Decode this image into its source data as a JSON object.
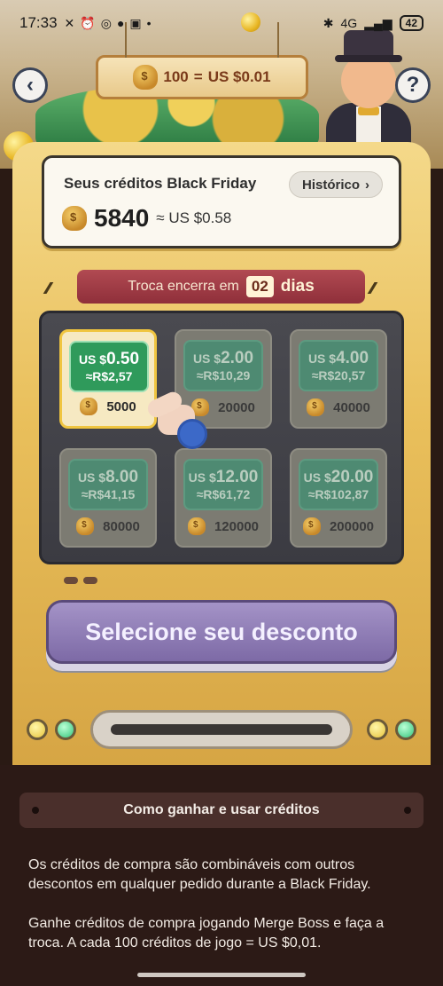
{
  "status": {
    "time": "17:33",
    "battery": "42",
    "network": "4G"
  },
  "header": {
    "rate_amount": "100",
    "rate_equals": "=",
    "rate_value": "US $0.01",
    "back_icon": "chevron-left-icon",
    "help_label": "?"
  },
  "credits": {
    "title": "Seus créditos Black Friday",
    "history_label": "Histórico",
    "amount": "5840",
    "approx": "≈ US $0.58"
  },
  "deadline": {
    "prefix": "Troca encerra em",
    "days": "02",
    "suffix": "dias"
  },
  "tiles": [
    {
      "usd_prefix": "US $",
      "usd": "0.50",
      "brl": "≈R$2,57",
      "cost": "5000",
      "selected": true
    },
    {
      "usd_prefix": "US $",
      "usd": "2.00",
      "brl": "≈R$10,29",
      "cost": "20000",
      "selected": false
    },
    {
      "usd_prefix": "US $",
      "usd": "4.00",
      "brl": "≈R$20,57",
      "cost": "40000",
      "selected": false
    },
    {
      "usd_prefix": "US $",
      "usd": "8.00",
      "brl": "≈R$41,15",
      "cost": "80000",
      "selected": false
    },
    {
      "usd_prefix": "US $",
      "usd": "12.00",
      "brl": "≈R$61,72",
      "cost": "120000",
      "selected": false
    },
    {
      "usd_prefix": "US $",
      "usd": "20.00",
      "brl": "≈R$102,87",
      "cost": "200000",
      "selected": false
    }
  ],
  "select_button": "Selecione seu desconto",
  "howto_label": "Como ganhar e usar créditos",
  "info": {
    "p1": "Os créditos de compra são combináveis com outros descontos em qualquer pedido durante a Black Friday.",
    "p2": "Ganhe créditos de compra jogando Merge Boss e faça a troca. A cada 100 créditos de jogo = US $0,01."
  }
}
